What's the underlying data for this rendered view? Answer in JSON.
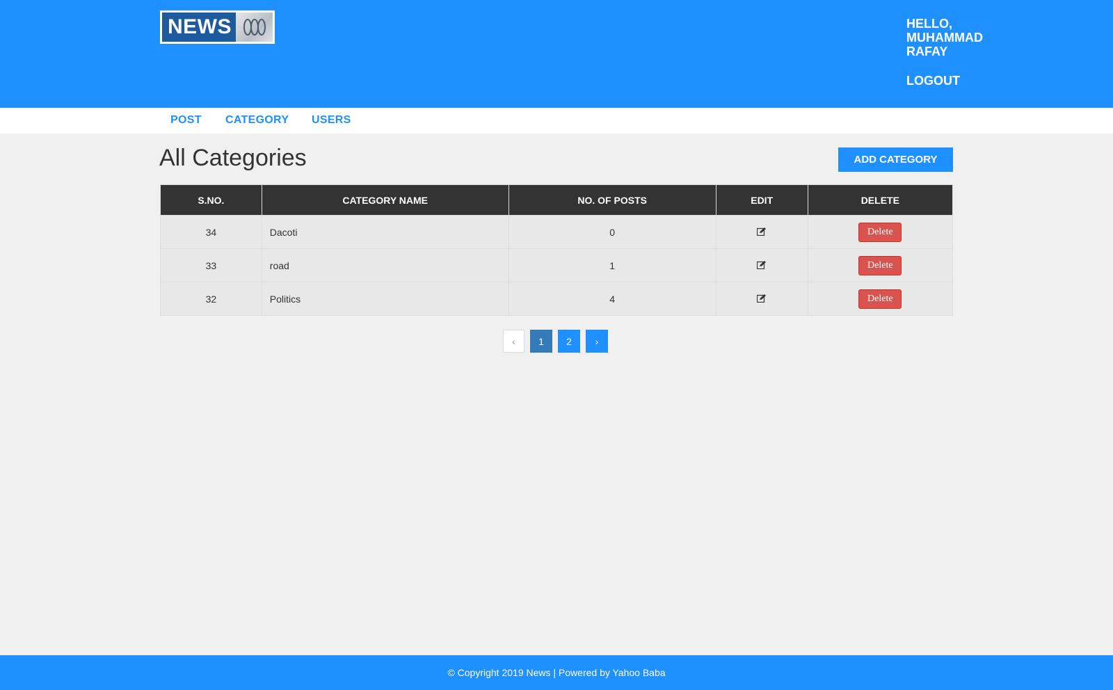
{
  "header": {
    "logo_text": "NEWS",
    "greeting": "HELLO, MUHAMMAD RAFAY",
    "logout_label": "LOGOUT"
  },
  "nav": {
    "items": [
      {
        "label": "POST"
      },
      {
        "label": "CATEGORY"
      },
      {
        "label": "USERS"
      }
    ]
  },
  "main": {
    "title": "All Categories",
    "add_button": "ADD CATEGORY",
    "table": {
      "headers": [
        "S.NO.",
        "CATEGORY NAME",
        "NO. OF POSTS",
        "EDIT",
        "DELETE"
      ],
      "rows": [
        {
          "sno": "34",
          "name": "Dacoti",
          "posts": "0",
          "delete_label": "Delete"
        },
        {
          "sno": "33",
          "name": "road",
          "posts": "1",
          "delete_label": "Delete"
        },
        {
          "sno": "32",
          "name": "Politics",
          "posts": "4",
          "delete_label": "Delete"
        }
      ]
    },
    "pagination": {
      "prev": "‹",
      "pages": [
        "1",
        "2"
      ],
      "next": "›",
      "current": "1"
    }
  },
  "footer": {
    "text": "© Copyright 2019 News | Powered by Yahoo Baba"
  },
  "colors": {
    "primary": "#1e90ff",
    "header_dark": "#333333",
    "delete_red": "#d9534f",
    "active_page": "#337ab7"
  },
  "icons": {
    "edit": "edit-icon"
  }
}
